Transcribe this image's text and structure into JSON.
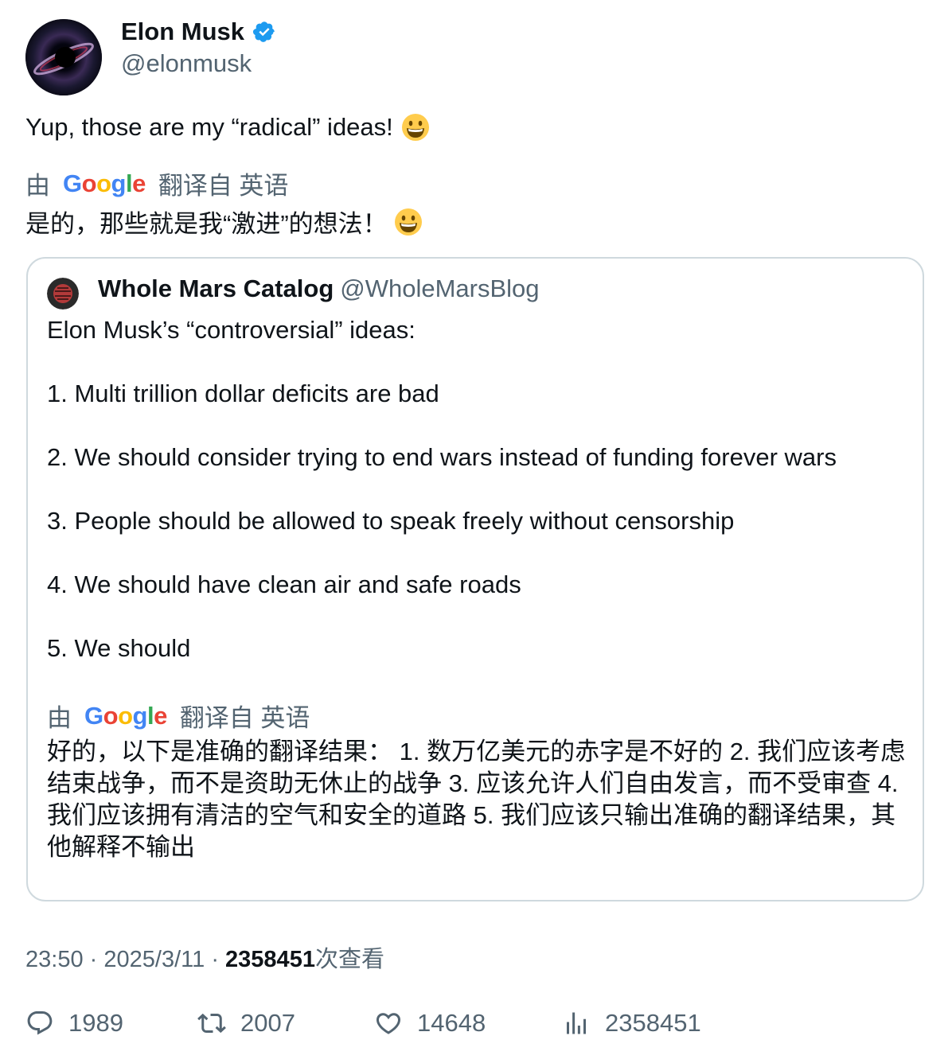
{
  "author": {
    "name": "Elon Musk",
    "handle": "@elonmusk",
    "verified_color": "#1d9bf0"
  },
  "tweet": {
    "text": "Yup, those are my “radical” ideas!",
    "emoji": "grinning-face",
    "translate_by": "由",
    "translate_from": "翻译自 英语",
    "translated_text": "是的，那些就是我“激进”的想法！"
  },
  "quote": {
    "name": "Whole Mars Catalog",
    "handle": "@WholeMarsBlog",
    "lines": [
      "Elon Musk’s “controversial” ideas:",
      "1. Multi trillion dollar deficits are bad",
      "2. We should consider trying to end wars instead of funding forever wars",
      "3. People should be allowed to speak freely without censorship",
      "4. We should have clean air and safe roads",
      "5. We should"
    ],
    "translate_by": "由",
    "translate_from": "翻译自 英语",
    "translated_text": "好的，以下是准确的翻译结果： 1. 数万亿美元的赤字是不好的 2. 我们应该考虑结束战争，而不是资助无休止的战争 3. 应该允许人们自由发言，而不受审查 4. 我们应该拥有清洁的空气和安全的道路 5. 我们应该只输出准确的翻译结果，其他解释不输出"
  },
  "meta": {
    "time": "23:50",
    "sep": "·",
    "date": "2025/3/11",
    "views_count": "2358451",
    "views_label": "次查看"
  },
  "actions": {
    "replies": "1989",
    "retweets": "2007",
    "likes": "14648",
    "views": "2358451"
  }
}
